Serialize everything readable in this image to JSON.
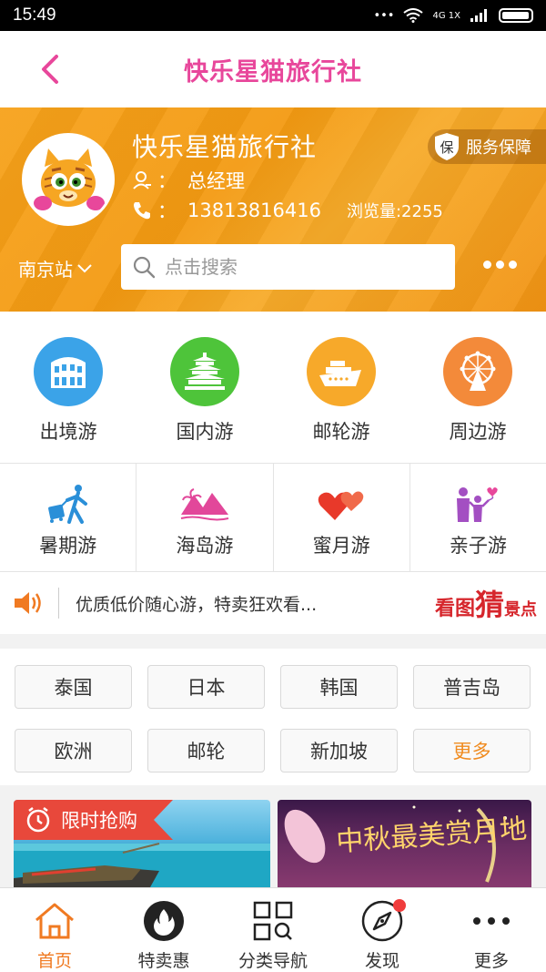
{
  "status_bar": {
    "time": "15:49",
    "network": "4G 1X"
  },
  "nav": {
    "title": "快乐星猫旅行社"
  },
  "profile": {
    "name": "快乐星猫旅行社",
    "guarantee_icon_text": "保",
    "guarantee_label": "服务保障",
    "role_colon": "：",
    "role": "总经理",
    "phone_colon": "：",
    "phone": "13813816416",
    "views": "浏览量:2255"
  },
  "location": {
    "city": "南京站"
  },
  "search": {
    "placeholder": "点击搜索"
  },
  "categories": [
    {
      "label": "出境游",
      "color": "#3ba3e8",
      "icon": "colosseum-icon"
    },
    {
      "label": "国内游",
      "color": "#4ec43a",
      "icon": "temple-icon"
    },
    {
      "label": "邮轮游",
      "color": "#f7a92a",
      "icon": "cruise-ship-icon"
    },
    {
      "label": "周边游",
      "color": "#f38a3a",
      "icon": "ferris-wheel-icon"
    }
  ],
  "themes": [
    {
      "label": "暑期游",
      "icon": "traveler-icon"
    },
    {
      "label": "海岛游",
      "icon": "island-icon"
    },
    {
      "label": "蜜月游",
      "icon": "hearts-icon"
    },
    {
      "label": "亲子游",
      "icon": "family-icon"
    }
  ],
  "notice": {
    "text": "优质低价随心游，特卖狂欢看...",
    "brand_a": "看图",
    "brand_b": "猜",
    "brand_c": "景点"
  },
  "destinations": [
    "泰国",
    "日本",
    "韩国",
    "普吉岛",
    "欧洲",
    "邮轮",
    "新加坡",
    "更多"
  ],
  "promos": {
    "flash_sale": "限时抢购",
    "moon_text": "中秋最美赏月地"
  },
  "tabs": [
    {
      "label": "首页",
      "icon": "home-icon"
    },
    {
      "label": "特卖惠",
      "icon": "flame-icon"
    },
    {
      "label": "分类导航",
      "icon": "category-grid-icon"
    },
    {
      "label": "发现",
      "icon": "compass-icon"
    },
    {
      "label": "更多",
      "icon": "more-dots-icon"
    }
  ],
  "colors": {
    "brand_pink": "#e8479b",
    "header_orange": "#f5a01a",
    "active_tab": "#f07a22",
    "more_link": "#f08b1f"
  }
}
